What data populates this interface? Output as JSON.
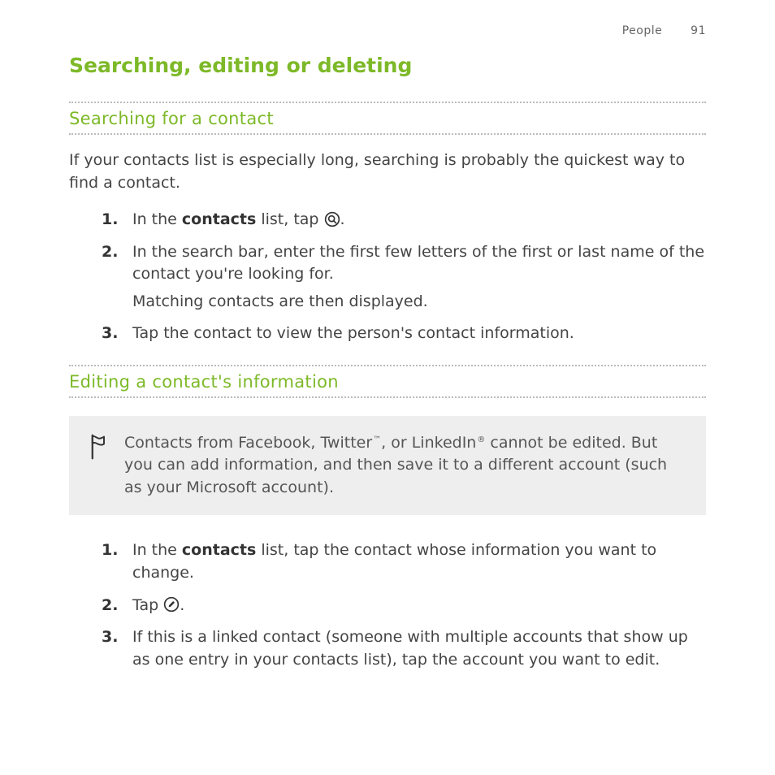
{
  "header": {
    "section_name": "People",
    "page_number": "91"
  },
  "title": "Searching, editing or deleting",
  "section1": {
    "heading": "Searching for a contact",
    "intro": "If your contacts list is especially long, searching is probably the quickest way to find a contact.",
    "steps": {
      "s1_pre": "In the ",
      "s1_bold": "contacts",
      "s1_mid": " list, tap ",
      "s1_post": ".",
      "s2_line1": "In the search bar, enter the first few letters of the first or last name of the contact you're looking for.",
      "s2_line2": "Matching contacts are then displayed.",
      "s3": "Tap the contact to view the person's contact information."
    }
  },
  "section2": {
    "heading": "Editing a contact's information",
    "note": {
      "pre": "Contacts from Facebook, Twitter",
      "tm": "™",
      "mid": ", or LinkedIn",
      "reg": "®",
      "post": " cannot be edited. But you can add information, and then save it to a different account (such as your Microsoft account)."
    },
    "steps": {
      "s1_pre": "In the ",
      "s1_bold": "contacts",
      "s1_post": " list, tap the contact whose information you want to change.",
      "s2_pre": "Tap ",
      "s2_post": ".",
      "s3": "If this is a linked contact (someone with multiple accounts that show up as one entry in your contacts list), tap the account you want to edit."
    }
  }
}
